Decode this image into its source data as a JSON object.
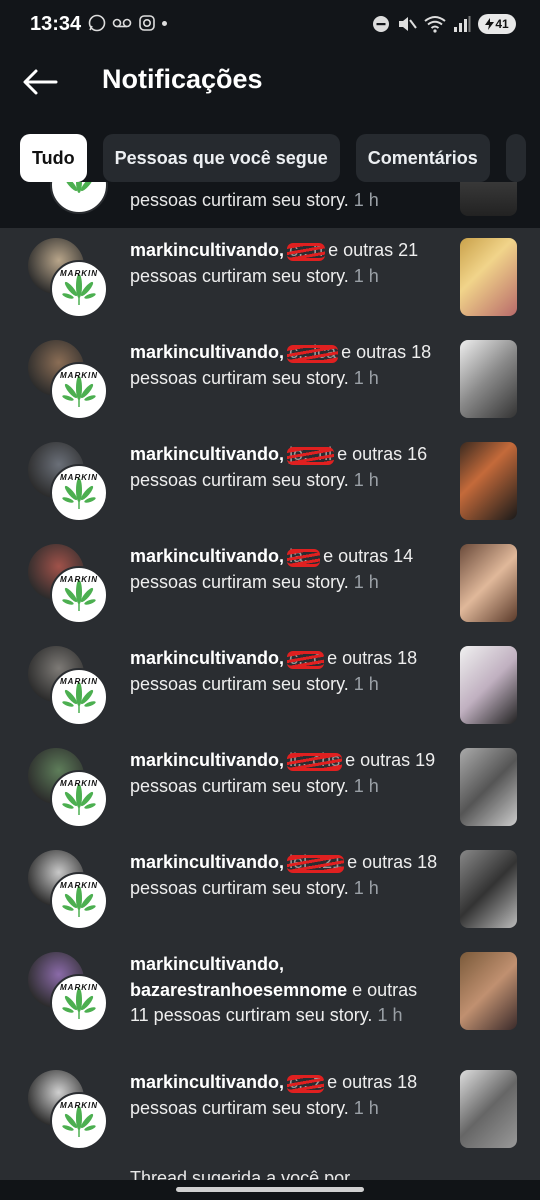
{
  "status_bar": {
    "time": "13:34",
    "battery": "41"
  },
  "header": {
    "title": "Notificações"
  },
  "filters": [
    {
      "label": "Tudo",
      "active": true
    },
    {
      "label": "Pessoas que você segue",
      "active": false
    },
    {
      "label": "Comentários",
      "active": false
    }
  ],
  "partial_top": {
    "text": "pessoas curtiram seu story.",
    "time": "1 h"
  },
  "avatar_badge": "MARKIN",
  "notifications": [
    {
      "user": "markincultivando,",
      "redacted": "c...n",
      "rest": " e outras 21 pessoas curtiram seu story.",
      "time": "1 h"
    },
    {
      "user": "markincultivando,",
      "redacted": "c...ica",
      "rest": " e outras 18 pessoas curtiram seu story.",
      "time": "1 h"
    },
    {
      "user": "markincultivando,",
      "redacted": "jo...ni",
      "rest": " e outras 16 pessoas curtiram seu story.",
      "time": "1 h"
    },
    {
      "user": "markincultivando,",
      "redacted": "la...",
      "rest": " e outras 14 pessoas curtiram seu story.",
      "time": "1 h"
    },
    {
      "user": "markincultivando,",
      "redacted": "c...c",
      "rest": " e outras 18 pessoas curtiram seu story.",
      "time": "1 h"
    },
    {
      "user": "markincultivando,",
      "redacted": "ll...chs",
      "rest": " e outras 19 pessoas curtiram seu story.",
      "time": "1 h"
    },
    {
      "user": "markincultivando,",
      "redacted": "lei...21",
      "rest": " e outras 18 pessoas curtiram seu story.",
      "time": "1 h"
    },
    {
      "user": "markincultivando,",
      "user2": "bazarestranhoesemnome",
      "rest": " e outras 11 pessoas curtiram seu story.",
      "time": "1 h"
    },
    {
      "user": "markincultivando,",
      "redacted": "c...z",
      "rest": " e outras 18 pessoas curtiram seu story.",
      "time": "1 h"
    }
  ],
  "partial_bottom": {
    "text": "Thread sugerida a você por"
  },
  "colors": {
    "background": "#2a2d31",
    "header": "#121519",
    "leaf": "#4caf50",
    "redaction": "#e02020"
  }
}
